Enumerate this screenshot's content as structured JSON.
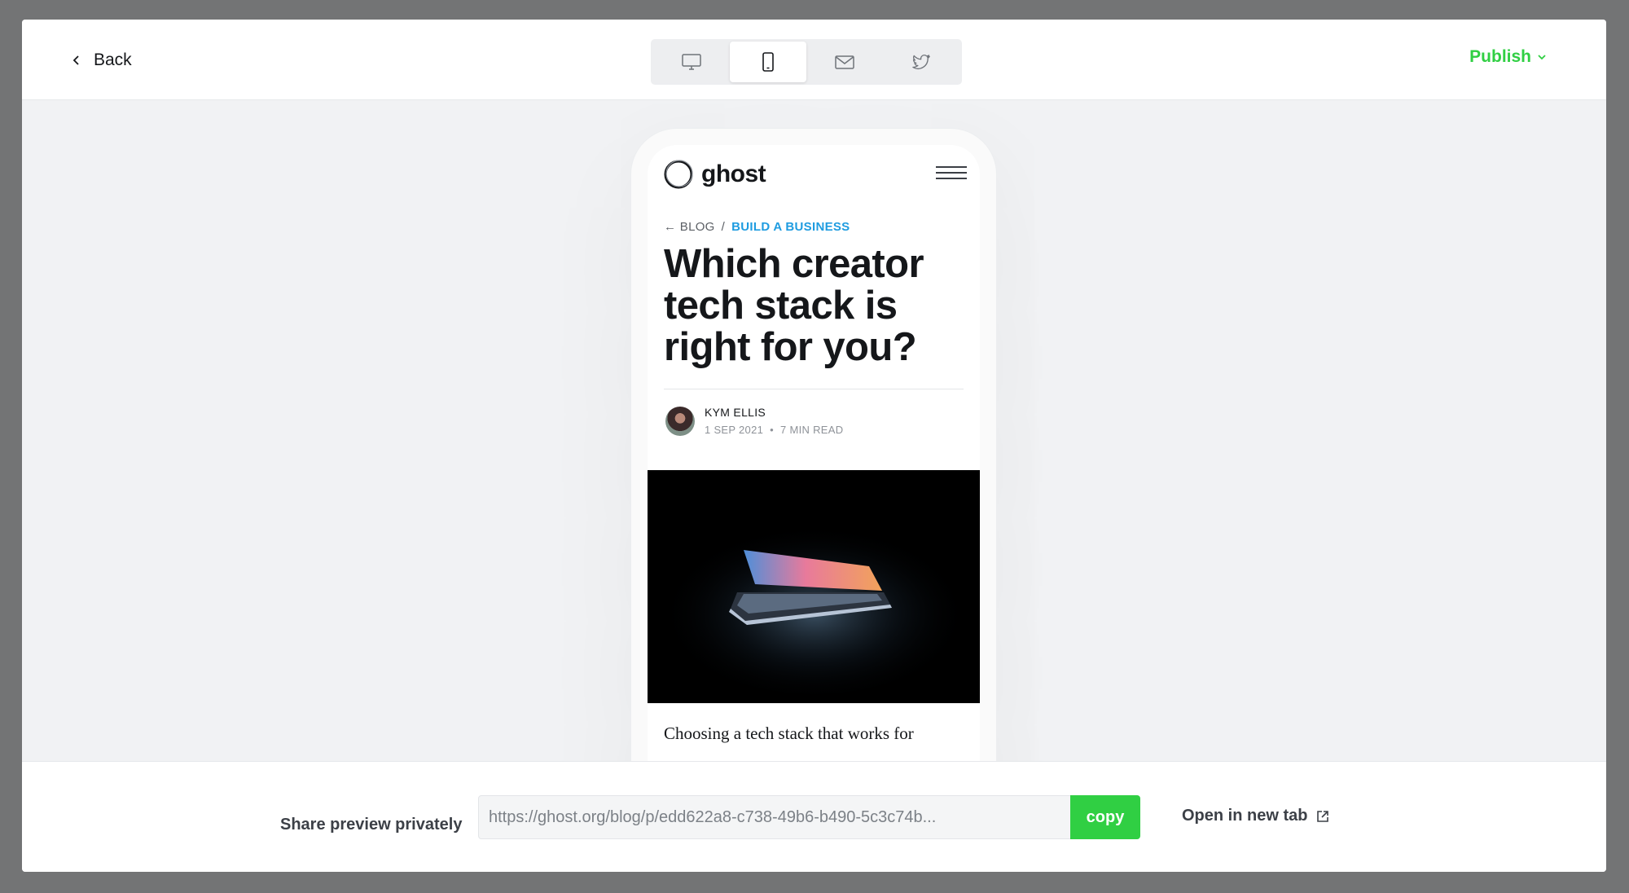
{
  "header": {
    "back_label": "Back",
    "publish_label": "Publish",
    "devices": [
      "desktop-icon",
      "mobile-icon",
      "email-icon",
      "twitter-icon"
    ],
    "active_device": "mobile"
  },
  "post": {
    "site_name": "ghost",
    "breadcrumb_back": "← BLOG",
    "breadcrumb_sep": "/",
    "breadcrumb_tag": "BUILD A BUSINESS",
    "title": "Which creator tech stack is right for you?",
    "author": "KYM ELLIS",
    "date": "1 SEP 2021",
    "separator": "•",
    "read_time": "7 MIN READ",
    "excerpt": "Choosing a tech stack that works for"
  },
  "footer": {
    "share_label": "Share preview privately",
    "share_url": "https://ghost.org/blog/p/edd622a8-c738-49b6-b490-5c3c74b...",
    "copy_label": "copy",
    "open_tab_label": "Open in new tab"
  },
  "colors": {
    "accent_green": "#30cf43",
    "tag_blue": "#1f9ce0",
    "overlay": "#737475"
  }
}
